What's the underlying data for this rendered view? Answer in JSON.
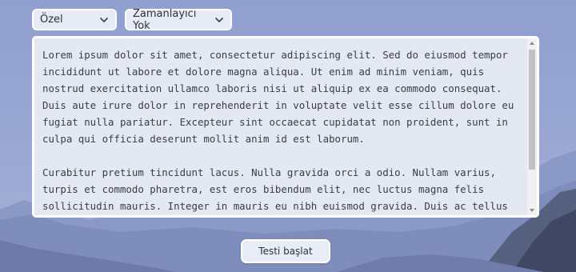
{
  "controls": {
    "mode_value": "Özel",
    "timer_value": "Zamanlayıcı Yok"
  },
  "text_panel": {
    "paragraphs": [
      "Lorem ipsum dolor sit amet, consectetur adipiscing elit. Sed do eiusmod tempor incididunt ut labore et dolore magna aliqua. Ut enim ad minim veniam, quis nostrud exercitation ullamco laboris nisi ut aliquip ex ea commodo consequat. Duis aute irure dolor in reprehenderit in voluptate velit esse cillum dolore eu fugiat nulla pariatur. Excepteur sint occaecat cupidatat non proident, sunt in culpa qui officia deserunt mollit anim id est laborum.",
      "Curabitur pretium tincidunt lacus. Nulla gravida orci a odio. Nullam varius, turpis et commodo pharetra, est eros bibendum elit, nec luctus magna felis sollicitudin mauris. Integer in mauris eu nibh euismod gravida. Duis ac tellus et risus vulputate vehicula. Donec lobortis risus a elit. Etiam tempor. Ut"
    ]
  },
  "actions": {
    "start_label": "Testi başlat"
  },
  "icons": {
    "select_chevron": "chevron-down-icon",
    "scroll_up": "scroll-up-arrow-icon",
    "scroll_down": "scroll-down-arrow-icon"
  },
  "colors": {
    "background": "#98a6d2",
    "panel": "#ffffff",
    "text_area": "#e4e8f3",
    "control": "#e6ebf6"
  }
}
